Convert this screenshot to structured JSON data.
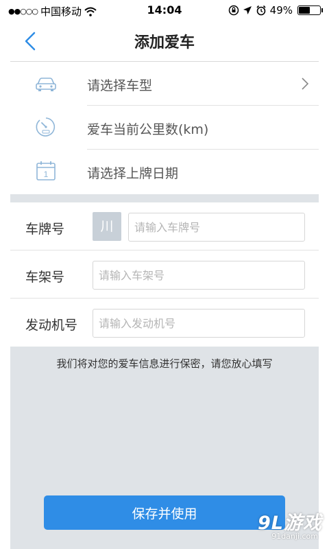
{
  "status_bar": {
    "signal": "●●○○○",
    "carrier": "中国移动",
    "time": "14:04",
    "battery_percent": "49%",
    "battery_level": 0.49
  },
  "nav": {
    "title": "添加爱车"
  },
  "car_info": {
    "items": [
      {
        "label": "请选择车型",
        "icon": "car-icon"
      },
      {
        "label": "爱车当前公里数(km)",
        "icon": "odometer-icon"
      },
      {
        "label": "请选择上牌日期",
        "icon": "calendar-icon",
        "calendar_day": "1"
      }
    ]
  },
  "form": {
    "plate_label": "车牌号",
    "plate_province": "川",
    "plate_placeholder": "请输入车牌号",
    "frame_label": "车架号",
    "frame_placeholder": "请输入车架号",
    "engine_label": "发动机号",
    "engine_placeholder": "请输入发动机号"
  },
  "privacy_note": "我们将对您的爱车信息进行保密，请您放心填写",
  "save_button_label": "保存并使用",
  "watermark": {
    "main": "9L游戏",
    "sub": "91danji.com"
  },
  "colors": {
    "accent": "#2f8de6",
    "icon": "#8fb6d8",
    "band": "#dfe3e7"
  }
}
